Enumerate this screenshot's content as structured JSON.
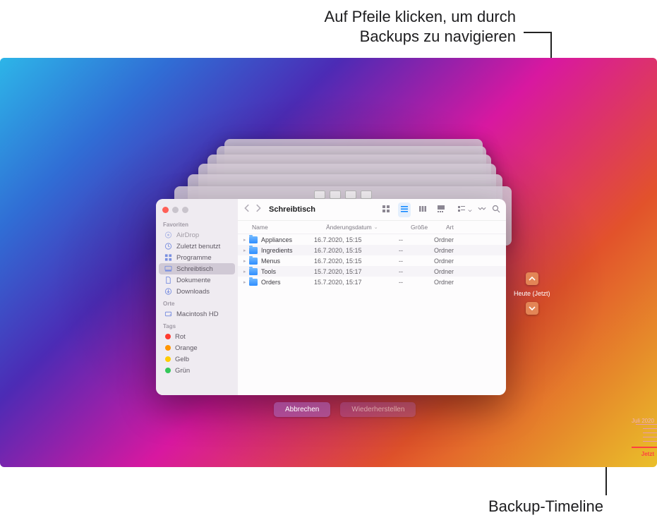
{
  "annotations": {
    "top": "Auf Pfeile klicken, um durch\nBackups zu navigieren",
    "bottom": "Backup-Timeline"
  },
  "nav": {
    "current_label": "Heute (Jetzt)"
  },
  "buttons": {
    "cancel": "Abbrechen",
    "restore": "Wiederherstellen"
  },
  "timeline": {
    "top_label": "Juli 2020",
    "now_label": "Jetzt"
  },
  "finder": {
    "title": "Schreibtisch",
    "columns": {
      "name": "Name",
      "date": "Änderungsdatum",
      "size": "Größe",
      "kind": "Art"
    },
    "rows": [
      {
        "name": "Appliances",
        "date": "16.7.2020, 15:15",
        "size": "--",
        "kind": "Ordner"
      },
      {
        "name": "Ingredients",
        "date": "16.7.2020, 15:15",
        "size": "--",
        "kind": "Ordner"
      },
      {
        "name": "Menus",
        "date": "16.7.2020, 15:15",
        "size": "--",
        "kind": "Ordner"
      },
      {
        "name": "Tools",
        "date": "15.7.2020, 15:17",
        "size": "--",
        "kind": "Ordner"
      },
      {
        "name": "Orders",
        "date": "15.7.2020, 15:17",
        "size": "--",
        "kind": "Ordner"
      }
    ]
  },
  "sidebar": {
    "section_favorites": "Favoriten",
    "favorites": [
      {
        "label": "AirDrop",
        "icon": "airdrop-icon",
        "dim": true
      },
      {
        "label": "Zuletzt benutzt",
        "icon": "clock-icon"
      },
      {
        "label": "Programme",
        "icon": "apps-icon"
      },
      {
        "label": "Schreibtisch",
        "icon": "desktop-icon",
        "selected": true
      },
      {
        "label": "Dokumente",
        "icon": "doc-icon"
      },
      {
        "label": "Downloads",
        "icon": "download-icon"
      }
    ],
    "section_locations": "Orte",
    "locations": [
      {
        "label": "Macintosh HD",
        "icon": "hdd-icon"
      }
    ],
    "section_tags": "Tags",
    "tags": [
      {
        "label": "Rot",
        "color": "#ff3b30"
      },
      {
        "label": "Orange",
        "color": "#ff9500"
      },
      {
        "label": "Gelb",
        "color": "#ffcc00"
      },
      {
        "label": "Grün",
        "color": "#34c759"
      }
    ]
  }
}
